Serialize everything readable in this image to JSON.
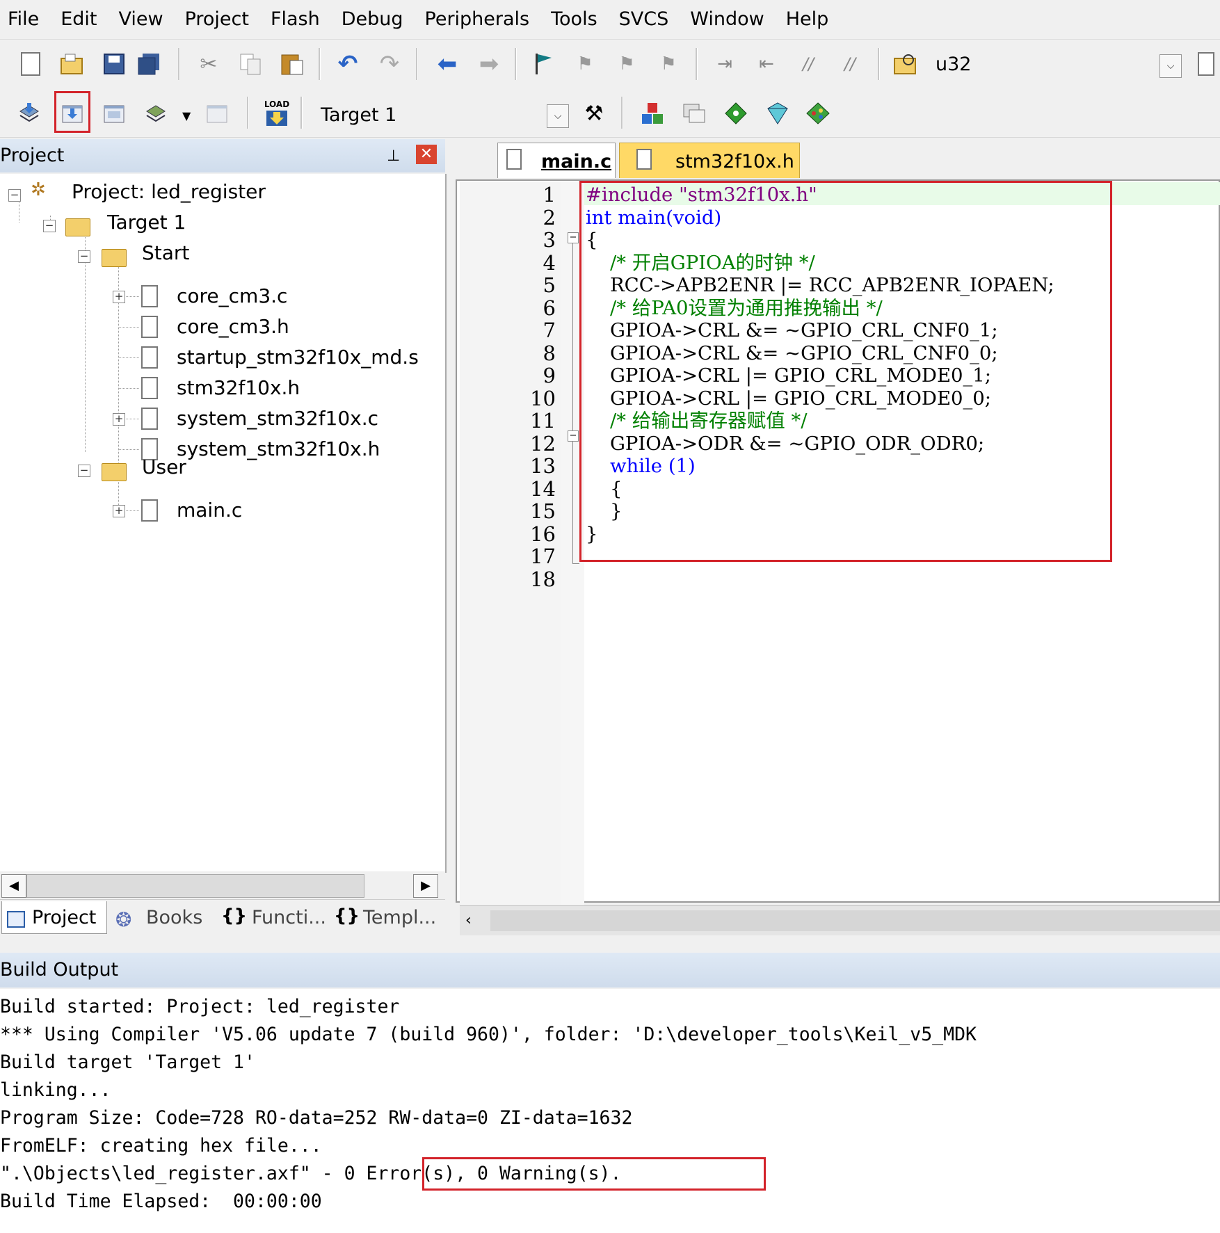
{
  "menu": [
    "File",
    "Edit",
    "View",
    "Project",
    "Flash",
    "Debug",
    "Peripherals",
    "Tools",
    "SVCS",
    "Window",
    "Help"
  ],
  "toolbar1": {
    "icons": [
      "new-file-icon",
      "open-file-icon",
      "save-icon",
      "save-all-icon",
      "cut-icon",
      "copy-icon",
      "paste-icon",
      "undo-icon",
      "redo-icon",
      "nav-back-icon",
      "nav-forward-icon",
      "bookmark-icon",
      "bookmark-prev-icon",
      "bookmark-next-icon",
      "bookmark-clear-icon",
      "indent-icon",
      "unindent-icon",
      "comment-icon",
      "uncomment-icon",
      "find-in-files-icon"
    ],
    "find_value": "u32"
  },
  "toolbar2": {
    "icons": [
      "translate-icon",
      "build-icon",
      "rebuild-icon",
      "batch-build-icon",
      "stop-build-icon",
      "download-icon",
      "target-options-icon",
      "manage-components-icon",
      "file-extensions-icon",
      "pack-installer-icon",
      "select-packs-icon",
      "run-time-env-icon"
    ],
    "load_label": "LOAD",
    "target_value": "Target 1"
  },
  "project_panel": {
    "title": "Project",
    "tree": {
      "root": "Project: led_register",
      "target": "Target 1",
      "groups": [
        {
          "name": "Start",
          "files": [
            "core_cm3.c",
            "core_cm3.h",
            "startup_stm32f10x_md.s",
            "stm32f10x.h",
            "system_stm32f10x.c",
            "system_stm32f10x.h"
          ]
        },
        {
          "name": "User",
          "files": [
            "main.c"
          ]
        }
      ]
    },
    "bottom_tabs": [
      "Project",
      "Books",
      "Functi...",
      "Templ..."
    ]
  },
  "editor": {
    "tabs": [
      "main.c",
      "stm32f10x.h"
    ],
    "active_tab": "main.c",
    "line_numbers": [
      "1",
      "2",
      "3",
      "4",
      "5",
      "6",
      "7",
      "8",
      "9",
      "10",
      "11",
      "12",
      "13",
      "14",
      "15",
      "16",
      "17",
      "18"
    ],
    "code": [
      "#include \"stm32f10x.h\"",
      "int main(void)",
      "{",
      "    /* 开启GPIOA的时钟 */",
      "    RCC->APB2ENR |= RCC_APB2ENR_IOPAEN;",
      "    /* 给PA0设置为通用推挽输出 */",
      "    GPIOA->CRL &= ~GPIO_CRL_CNF0_1;",
      "    GPIOA->CRL &= ~GPIO_CRL_CNF0_0;",
      "    GPIOA->CRL |= GPIO_CRL_MODE0_1;",
      "    GPIOA->CRL |= GPIO_CRL_MODE0_0;",
      "    /* 给输出寄存器赋值 */",
      "    GPIOA->ODR &= ~GPIO_ODR_ODR0;",
      "    while (1)",
      "    {",
      "    }",
      "}",
      "",
      ""
    ]
  },
  "build_output": {
    "title": "Build Output",
    "lines": [
      "Build started: Project: led_register",
      "*** Using Compiler 'V5.06 update 7 (build 960)', folder: 'D:\\developer_tools\\Keil_v5_MDK",
      "Build target 'Target 1'",
      "linking...",
      "Program Size: Code=728 RO-data=252 RW-data=0 ZI-data=1632",
      "FromELF: creating hex file...",
      "\".\\Objects\\led_register.axf\" - 0 Error(s), 0 Warning(s).",
      "Build Time Elapsed:  00:00:00"
    ]
  },
  "colors": {
    "highlight_box": "#d3232a",
    "keyword": "#0000ff",
    "comment": "#008000",
    "preprocessor": "#800080"
  }
}
